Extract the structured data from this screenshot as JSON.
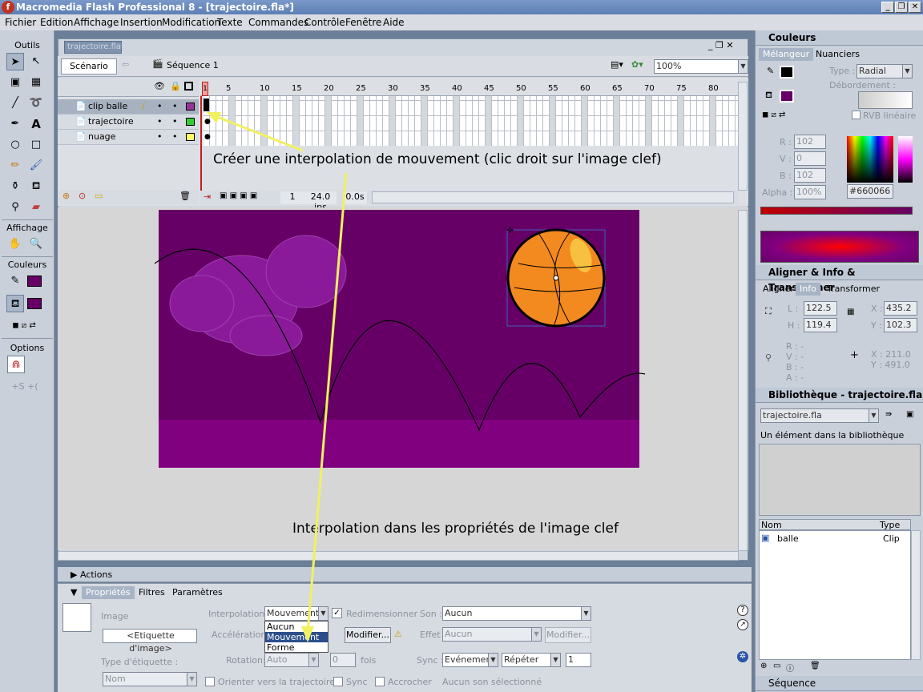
{
  "window": {
    "app_title": "Macromedia Flash Professional 8 - [trajectoire.fla*]",
    "minimize": "_",
    "restore": "❐",
    "close": "✕"
  },
  "menu": [
    "Fichier",
    "Edition",
    "Affichage",
    "Insertion",
    "Modification",
    "Texte",
    "Commandes",
    "Contrôle",
    "Fenêtre",
    "Aide"
  ],
  "tools": {
    "title": "Outils",
    "view_title": "Affichage",
    "colors_title": "Couleurs",
    "options_title": "Options",
    "stroke_color": "#000000",
    "fill_color": "#660066"
  },
  "document": {
    "tab": "trajectoire.fla*",
    "scene_button": "Scénario",
    "sequence": "Séquence 1",
    "zoom": "100%"
  },
  "timeline": {
    "ruler": [
      "1",
      "5",
      "10",
      "15",
      "20",
      "25",
      "30",
      "35",
      "40",
      "45",
      "50",
      "55",
      "60",
      "65",
      "70",
      "75",
      "80"
    ],
    "layers": [
      {
        "name": "clip balle",
        "color": "#993399"
      },
      {
        "name": "trajectoire",
        "color": "#33cc33"
      },
      {
        "name": "nuage",
        "color": "#ffff66"
      }
    ],
    "current_frame": "1",
    "fps": "24.0 ips",
    "time": "0.0s"
  },
  "annotations": {
    "top": "Créer une interpolation de mouvement (clic droit sur l'image clef)",
    "bottom": "Interpolation dans les propriétés de l'image clef"
  },
  "stage": {
    "background": "#660066",
    "floor": "#800080",
    "ball_color": "#f28a1f"
  },
  "actions_panel": {
    "title": "Actions"
  },
  "properties": {
    "tabs": [
      "Propriétés",
      "Filtres",
      "Paramètres"
    ],
    "image_label": "Image",
    "frame_label_placeholder": "<Etiquette d'image>",
    "label_type_label": "Type d'étiquette :",
    "label_type_value": "Nom",
    "interpolation_label": "Interpolation:",
    "interpolation_value": "Mouvement",
    "interpolation_options": [
      "Aucun",
      "Mouvement",
      "Forme"
    ],
    "resize_label": "Redimensionner",
    "acceleration_label": "Accélération:",
    "modify_button": "Modifier...",
    "rotation_label": "Rotation:",
    "rotation_value": "Auto",
    "times_value": "0",
    "times_label": "fois",
    "orient_label": "Orienter vers la trajectoire",
    "sync_check_label": "Sync",
    "snap_label": "Accrocher",
    "sound_label": "Son :",
    "sound_value": "Aucun",
    "effect_label": "Effet :",
    "effect_value": "Aucun",
    "effect_modify": "Modifier...",
    "sync_label": "Sync :",
    "sync_value": "Evénement",
    "repeat_value": "Répéter",
    "repeat_count": "1",
    "no_sound": "Aucun son sélectionné"
  },
  "colors_panel": {
    "title": "Couleurs",
    "tabs": [
      "Mélangeur",
      "Nuanciers"
    ],
    "type_label": "Type :",
    "type_value": "Radial",
    "overflow_label": "Débordement :",
    "linear_rgb": "RVB linéaire",
    "r_label": "R :",
    "r": "102",
    "v_label": "V :",
    "v": "0",
    "b_label": "B :",
    "b": "102",
    "alpha_label": "Alpha :",
    "alpha": "100%",
    "hex": "#660066"
  },
  "align_panel": {
    "title": "Aligner & Info & Transformer",
    "tabs": [
      "Aligner",
      "Info",
      "Transformer"
    ],
    "l_label": "L :",
    "l": "122.5",
    "h_label": "H :",
    "h": "119.4",
    "x_label": "X :",
    "x": "435.2",
    "y_label": "Y :",
    "y": "102.3",
    "r_info": "R : -",
    "v_info": "V : -",
    "b_info": "B : -",
    "a_info": "A : -",
    "x_info": "X : 211.0",
    "y_info": "Y : 491.0"
  },
  "library": {
    "title": "Bibliothèque - trajectoire.fla",
    "doc": "trajectoire.fla",
    "count": "Un élément dans la bibliothèque",
    "col_name": "Nom",
    "col_type": "Type",
    "items": [
      {
        "name": "balle",
        "type": "Clip"
      }
    ]
  },
  "scene_panel": {
    "title": "Séquence"
  }
}
